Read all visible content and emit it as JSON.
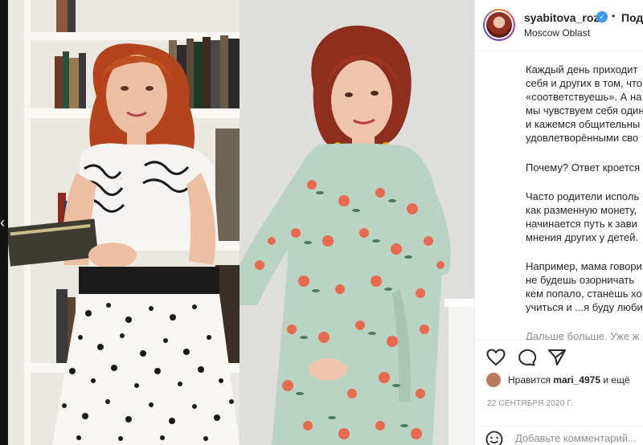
{
  "post": {
    "username": "syabitova_roza",
    "follow_label": "Подп",
    "location": "Moscow Oblast",
    "caption_lines": [
      "Каждый день приходит",
      "себя и других в том, что",
      "«соответствуешь». А на",
      "мы чувствуем себя один",
      "и кажемся общительны",
      "удовлетворёнными сво",
      "Почему? Ответ кроется",
      "Часто родители исполь",
      "как разменную монету,",
      "начинается путь к зави",
      "мнения других у детей.",
      "Например, мама говори",
      "не будешь озорничать",
      "кем попало, станешь хо",
      "учиться и ...я буду люби",
      "Дальше больше. Уже ж"
    ],
    "likes_label": "Нравится",
    "likes_user": "mari_4975",
    "likes_suffix": "и ещё",
    "date": "22 СЕНТЯБРЯ 2020 Г.",
    "comment_placeholder": "Добавьте комментарий..."
  },
  "icons": {
    "verified": "verified-badge-icon",
    "like": "heart-icon",
    "comment": "comment-bubble-icon",
    "share": "paper-plane-icon",
    "emoji": "emoji-smile-icon",
    "prev": "chevron-left-icon"
  },
  "colors": {
    "verified_blue": "#3897f0",
    "text_primary": "#262626",
    "text_secondary": "#8e8e8e",
    "divider": "#efefef"
  }
}
